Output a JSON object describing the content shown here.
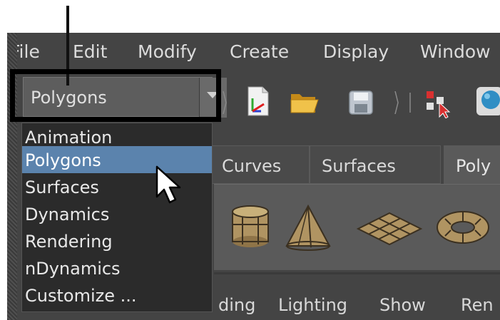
{
  "menubar": {
    "items": [
      {
        "label": "File"
      },
      {
        "label": "Edit"
      },
      {
        "label": "Modify"
      },
      {
        "label": "Create"
      },
      {
        "label": "Display"
      },
      {
        "label": "Window"
      }
    ]
  },
  "menu_set_selector": {
    "value": "Polygons"
  },
  "toolbar_icons": [
    "new-scene-icon",
    "open-folder-icon",
    "save-disk-icon",
    "select-by-component-icon",
    "sphere-icon"
  ],
  "dropdown": {
    "items": [
      {
        "label": "Animation"
      },
      {
        "label": "Polygons"
      },
      {
        "label": "Surfaces"
      },
      {
        "label": "Dynamics"
      },
      {
        "label": "Rendering"
      },
      {
        "label": "nDynamics"
      },
      {
        "label": "Customize ..."
      }
    ],
    "selected_index": 1,
    "highlight_color": "#5b83ad"
  },
  "shelf": {
    "tabs": [
      {
        "label": "Curves"
      },
      {
        "label": "Surfaces"
      },
      {
        "label": "Poly"
      }
    ],
    "active_tab_index": 2,
    "icons": [
      "cylinder-icon",
      "cone-icon",
      "plane-icon",
      "torus-icon"
    ]
  },
  "panel_menu": {
    "items": [
      {
        "label": "ding"
      },
      {
        "label": "Lighting"
      },
      {
        "label": "Show"
      },
      {
        "label": "Ren"
      }
    ]
  },
  "annotation": {
    "highlight_color": "#000000"
  }
}
